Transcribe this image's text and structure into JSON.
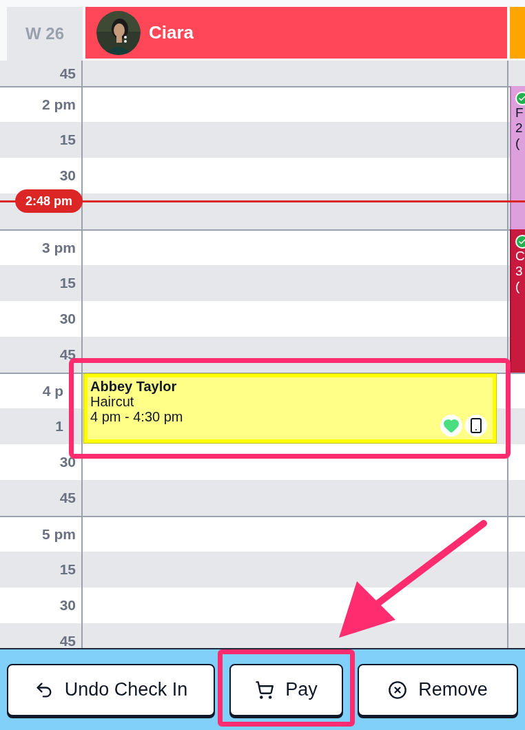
{
  "week": "W 26",
  "staff": [
    {
      "name": "Ciara",
      "color": "#ff4757"
    },
    {
      "color": "#ffa502"
    }
  ],
  "time_rows": [
    {
      "label": "45",
      "hour": false,
      "shaded": true
    },
    {
      "label": "2 pm",
      "hour": true,
      "shaded": false
    },
    {
      "label": "15",
      "hour": false,
      "shaded": true
    },
    {
      "label": "30",
      "hour": false,
      "shaded": false
    },
    {
      "hour": false,
      "shaded": true
    },
    {
      "label": "3 pm",
      "hour": true,
      "shaded": false
    },
    {
      "label": "15",
      "hour": false,
      "shaded": true
    },
    {
      "label": "30",
      "hour": false,
      "shaded": false
    },
    {
      "label": "45",
      "hour": false,
      "shaded": true
    },
    {
      "label": "4 p",
      "hour": true,
      "shaded": false
    },
    {
      "label": "1",
      "hour": false,
      "shaded": true
    },
    {
      "label": "30",
      "hour": false,
      "shaded": false
    },
    {
      "label": "45",
      "hour": false,
      "shaded": true
    },
    {
      "label": "5 pm",
      "hour": true,
      "shaded": false
    },
    {
      "label": "15",
      "hour": false,
      "shaded": true
    },
    {
      "label": "30",
      "hour": false,
      "shaded": false
    },
    {
      "label": "45",
      "hour": false,
      "shaded": true
    }
  ],
  "now_marker": {
    "label": "2:48 pm"
  },
  "appointment": {
    "client": "Abbey Taylor",
    "service": "Haircut",
    "time": "4 pm - 4:30 pm",
    "favorite": true,
    "booked_online": true,
    "highlighted": true
  },
  "other_appointments": [
    {
      "lines": [
        "F",
        "2",
        "("
      ],
      "color": "#dda0dd",
      "checked_in": true
    },
    {
      "lines": [
        "C",
        "3",
        "("
      ],
      "color": "#c8193f",
      "checked_in": true
    }
  ],
  "actions": [
    {
      "label": "Undo Check In",
      "kind": "undo",
      "highlighted": false
    },
    {
      "label": "Pay",
      "kind": "pay",
      "highlighted": true
    },
    {
      "label": "Remove",
      "kind": "remove",
      "highlighted": false
    }
  ]
}
